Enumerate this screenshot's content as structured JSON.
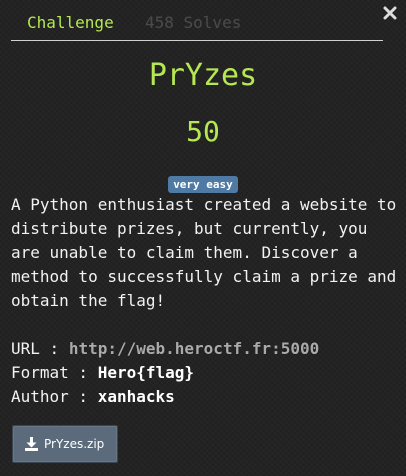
{
  "modal": {
    "tabs": {
      "challenge": "Challenge",
      "solves": "458 Solves"
    },
    "close_icon": "close-icon"
  },
  "challenge": {
    "name": "PrYzes",
    "points": "50",
    "difficulty": "very easy",
    "description": "A Python enthusiast created a website to distribute prizes, but currently, you are unable to claim them. Discover a method to successfully claim a prize and obtain the flag!",
    "url_label": "URL :",
    "url_value": "http://web.heroctf.fr:5000",
    "format_label": "Format :",
    "format_value": "Hero{flag}",
    "author_label": "Author :",
    "author_value": "xanhacks"
  },
  "files": {
    "download_label": "PrYzes.zip",
    "download_icon": "download-icon"
  },
  "colors": {
    "accent": "#b5e853",
    "badge": "#4e7aa3",
    "background": "#232323",
    "button": "#5b6b7c"
  }
}
